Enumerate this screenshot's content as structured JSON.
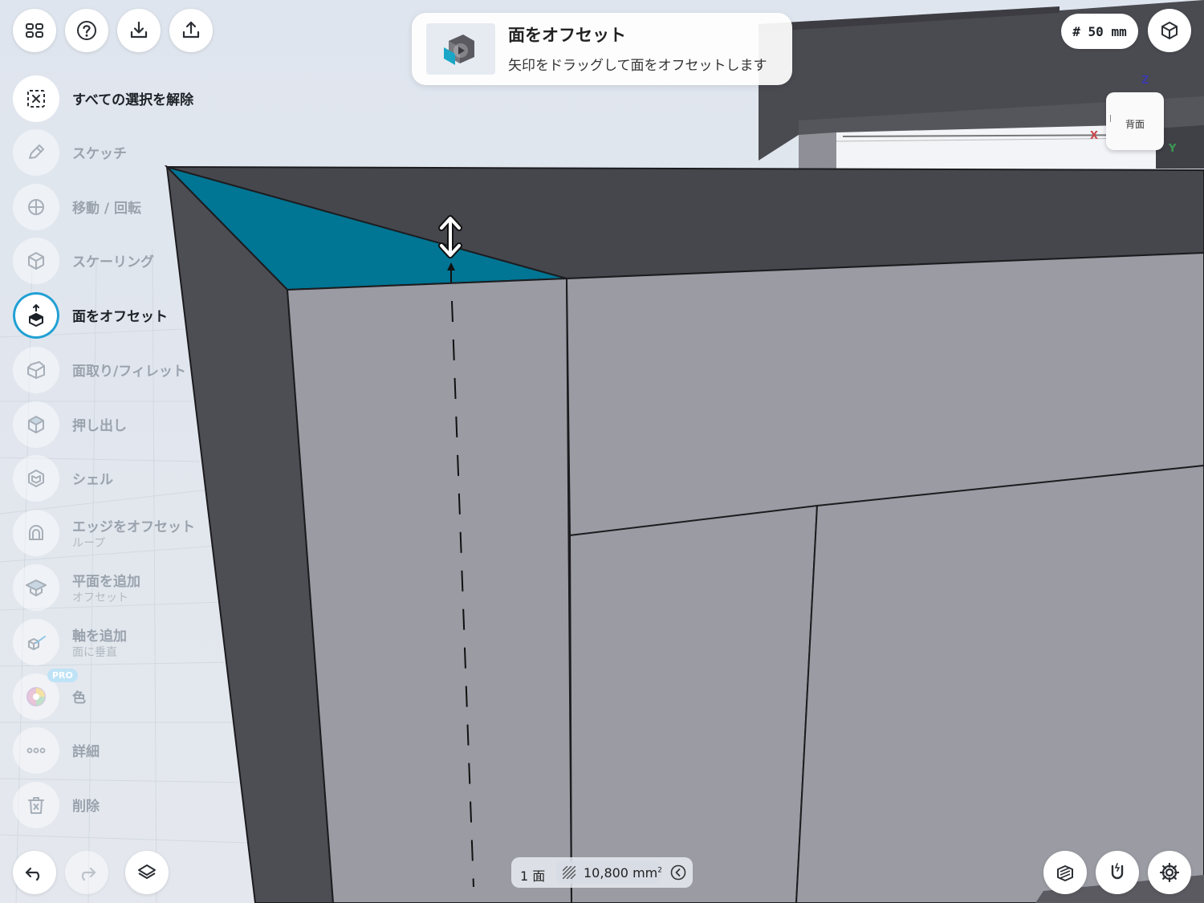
{
  "header": {
    "hint_title": "面をオフセット",
    "hint_desc": "矢印をドラッグして面をオフセットします",
    "grid_size": "# 50 mm"
  },
  "tools": [
    {
      "id": "deselect",
      "label": "すべての選択を解除",
      "sub": "",
      "state": "strong",
      "icon": "deselect-icon"
    },
    {
      "id": "sketch",
      "label": "スケッチ",
      "sub": "",
      "state": "disabled",
      "icon": "pencil-icon"
    },
    {
      "id": "move",
      "label": "移動 / 回転",
      "sub": "",
      "state": "disabled",
      "icon": "move-rotate-icon"
    },
    {
      "id": "scale",
      "label": "スケーリング",
      "sub": "",
      "state": "disabled",
      "icon": "scale-cube-icon"
    },
    {
      "id": "offset-face",
      "label": "面をオフセット",
      "sub": "",
      "state": "active",
      "icon": "offset-face-icon"
    },
    {
      "id": "chamfer",
      "label": "面取り/フィレット",
      "sub": "",
      "state": "disabled",
      "icon": "chamfer-icon"
    },
    {
      "id": "extrude",
      "label": "押し出し",
      "sub": "",
      "state": "disabled",
      "icon": "extrude-icon"
    },
    {
      "id": "shell",
      "label": "シェル",
      "sub": "",
      "state": "disabled",
      "icon": "shell-icon"
    },
    {
      "id": "offset-edge",
      "label": "エッジをオフセット",
      "sub": "ループ",
      "state": "disabled",
      "icon": "offset-edge-icon"
    },
    {
      "id": "add-plane",
      "label": "平面を追加",
      "sub": "オフセット",
      "state": "disabled",
      "icon": "plane-icon"
    },
    {
      "id": "add-axis",
      "label": "軸を追加",
      "sub": "面に垂直",
      "state": "disabled",
      "icon": "axis-icon"
    },
    {
      "id": "color",
      "label": "色",
      "sub": "",
      "state": "disabled",
      "icon": "color-wheel-icon",
      "badge": "PRO"
    },
    {
      "id": "details",
      "label": "詳細",
      "sub": "",
      "state": "disabled",
      "icon": "more-icon"
    },
    {
      "id": "delete",
      "label": "削除",
      "sub": "",
      "state": "disabled",
      "icon": "trash-icon"
    }
  ],
  "status": {
    "face_count": "1 面",
    "area_value": "10,800 mm",
    "area_unit_sup": "2"
  },
  "viewcube": {
    "face": "背面",
    "axis_z": "Z",
    "axis_x": "X",
    "axis_y": "Y"
  },
  "colors": {
    "selected_face": "#007594",
    "active_ring": "#21a0d4",
    "dark_face": "#46464d",
    "light_face": "#9a9ba3"
  }
}
